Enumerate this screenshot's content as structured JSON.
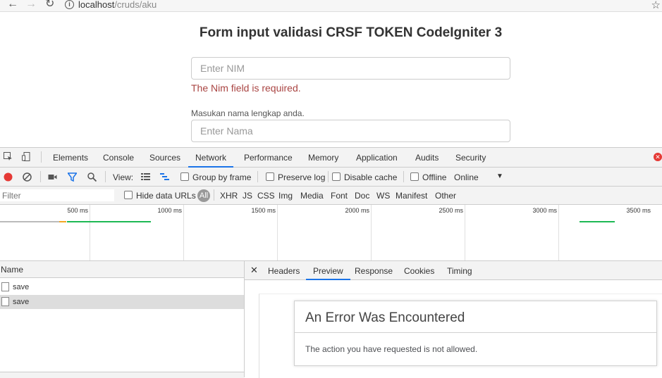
{
  "browser": {
    "url_host": "localhost",
    "url_path": "/cruds/aku"
  },
  "form": {
    "title": "Form input validasi CRSF TOKEN CodeIgniter 3",
    "nim_placeholder": "Enter NIM",
    "nim_error": "The Nim field is required.",
    "nama_help": "Masukan nama lengkap anda.",
    "nama_placeholder": "Enter Nama"
  },
  "devtools": {
    "tabs": [
      "Elements",
      "Console",
      "Sources",
      "Network",
      "Performance",
      "Memory",
      "Application",
      "Audits",
      "Security"
    ],
    "active_tab": "Network",
    "toolbar": {
      "view_label": "View:",
      "group_by_frame": "Group by frame",
      "preserve_log": "Preserve log",
      "disable_cache": "Disable cache",
      "offline": "Offline",
      "throttle": "Online"
    },
    "filter": {
      "placeholder": "Filter",
      "hide_data_urls": "Hide data URLs",
      "all": "All",
      "types": [
        "XHR",
        "JS",
        "CSS",
        "Img",
        "Media",
        "Font",
        "Doc",
        "WS",
        "Manifest",
        "Other"
      ]
    },
    "timeline": {
      "ticks": [
        "500 ms",
        "1000 ms",
        "1500 ms",
        "2000 ms",
        "2500 ms",
        "3000 ms",
        "3500 ms"
      ]
    },
    "requests": {
      "header": "Name",
      "rows": [
        "save",
        "save"
      ],
      "selected_index": 1
    },
    "detail": {
      "tabs": [
        "Headers",
        "Preview",
        "Response",
        "Cookies",
        "Timing"
      ],
      "active_tab": "Preview",
      "error_title": "An Error Was Encountered",
      "error_message": "The action you have requested is not allowed."
    },
    "colors": {
      "accent": "#1a73e8",
      "record": "#e53935",
      "bar_green": "#1db954",
      "bar_orange": "#f4a623"
    }
  }
}
